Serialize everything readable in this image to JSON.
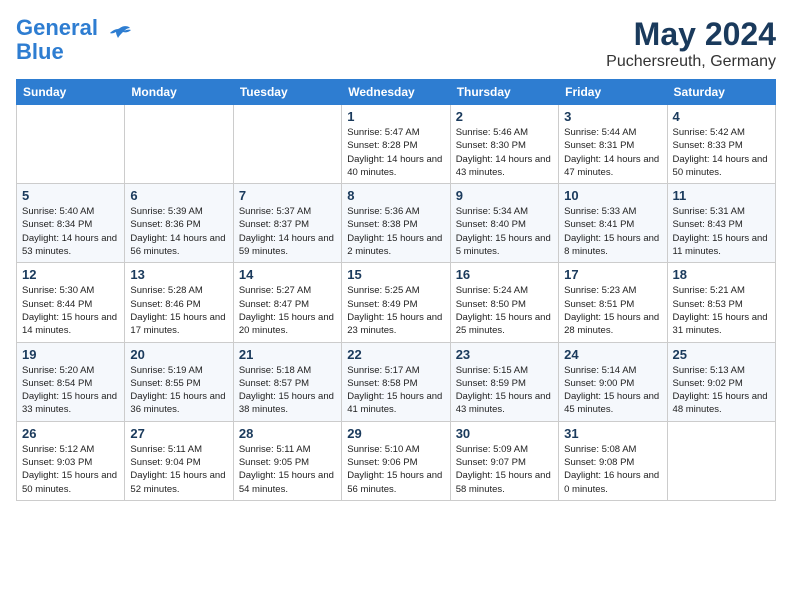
{
  "header": {
    "logo_line1": "General",
    "logo_line2": "Blue",
    "title": "May 2024",
    "subtitle": "Puchersreuth, Germany"
  },
  "weekdays": [
    "Sunday",
    "Monday",
    "Tuesday",
    "Wednesday",
    "Thursday",
    "Friday",
    "Saturday"
  ],
  "weeks": [
    [
      {
        "day": "",
        "info": ""
      },
      {
        "day": "",
        "info": ""
      },
      {
        "day": "",
        "info": ""
      },
      {
        "day": "1",
        "info": "Sunrise: 5:47 AM\nSunset: 8:28 PM\nDaylight: 14 hours and 40 minutes."
      },
      {
        "day": "2",
        "info": "Sunrise: 5:46 AM\nSunset: 8:30 PM\nDaylight: 14 hours and 43 minutes."
      },
      {
        "day": "3",
        "info": "Sunrise: 5:44 AM\nSunset: 8:31 PM\nDaylight: 14 hours and 47 minutes."
      },
      {
        "day": "4",
        "info": "Sunrise: 5:42 AM\nSunset: 8:33 PM\nDaylight: 14 hours and 50 minutes."
      }
    ],
    [
      {
        "day": "5",
        "info": "Sunrise: 5:40 AM\nSunset: 8:34 PM\nDaylight: 14 hours and 53 minutes."
      },
      {
        "day": "6",
        "info": "Sunrise: 5:39 AM\nSunset: 8:36 PM\nDaylight: 14 hours and 56 minutes."
      },
      {
        "day": "7",
        "info": "Sunrise: 5:37 AM\nSunset: 8:37 PM\nDaylight: 14 hours and 59 minutes."
      },
      {
        "day": "8",
        "info": "Sunrise: 5:36 AM\nSunset: 8:38 PM\nDaylight: 15 hours and 2 minutes."
      },
      {
        "day": "9",
        "info": "Sunrise: 5:34 AM\nSunset: 8:40 PM\nDaylight: 15 hours and 5 minutes."
      },
      {
        "day": "10",
        "info": "Sunrise: 5:33 AM\nSunset: 8:41 PM\nDaylight: 15 hours and 8 minutes."
      },
      {
        "day": "11",
        "info": "Sunrise: 5:31 AM\nSunset: 8:43 PM\nDaylight: 15 hours and 11 minutes."
      }
    ],
    [
      {
        "day": "12",
        "info": "Sunrise: 5:30 AM\nSunset: 8:44 PM\nDaylight: 15 hours and 14 minutes."
      },
      {
        "day": "13",
        "info": "Sunrise: 5:28 AM\nSunset: 8:46 PM\nDaylight: 15 hours and 17 minutes."
      },
      {
        "day": "14",
        "info": "Sunrise: 5:27 AM\nSunset: 8:47 PM\nDaylight: 15 hours and 20 minutes."
      },
      {
        "day": "15",
        "info": "Sunrise: 5:25 AM\nSunset: 8:49 PM\nDaylight: 15 hours and 23 minutes."
      },
      {
        "day": "16",
        "info": "Sunrise: 5:24 AM\nSunset: 8:50 PM\nDaylight: 15 hours and 25 minutes."
      },
      {
        "day": "17",
        "info": "Sunrise: 5:23 AM\nSunset: 8:51 PM\nDaylight: 15 hours and 28 minutes."
      },
      {
        "day": "18",
        "info": "Sunrise: 5:21 AM\nSunset: 8:53 PM\nDaylight: 15 hours and 31 minutes."
      }
    ],
    [
      {
        "day": "19",
        "info": "Sunrise: 5:20 AM\nSunset: 8:54 PM\nDaylight: 15 hours and 33 minutes."
      },
      {
        "day": "20",
        "info": "Sunrise: 5:19 AM\nSunset: 8:55 PM\nDaylight: 15 hours and 36 minutes."
      },
      {
        "day": "21",
        "info": "Sunrise: 5:18 AM\nSunset: 8:57 PM\nDaylight: 15 hours and 38 minutes."
      },
      {
        "day": "22",
        "info": "Sunrise: 5:17 AM\nSunset: 8:58 PM\nDaylight: 15 hours and 41 minutes."
      },
      {
        "day": "23",
        "info": "Sunrise: 5:15 AM\nSunset: 8:59 PM\nDaylight: 15 hours and 43 minutes."
      },
      {
        "day": "24",
        "info": "Sunrise: 5:14 AM\nSunset: 9:00 PM\nDaylight: 15 hours and 45 minutes."
      },
      {
        "day": "25",
        "info": "Sunrise: 5:13 AM\nSunset: 9:02 PM\nDaylight: 15 hours and 48 minutes."
      }
    ],
    [
      {
        "day": "26",
        "info": "Sunrise: 5:12 AM\nSunset: 9:03 PM\nDaylight: 15 hours and 50 minutes."
      },
      {
        "day": "27",
        "info": "Sunrise: 5:11 AM\nSunset: 9:04 PM\nDaylight: 15 hours and 52 minutes."
      },
      {
        "day": "28",
        "info": "Sunrise: 5:11 AM\nSunset: 9:05 PM\nDaylight: 15 hours and 54 minutes."
      },
      {
        "day": "29",
        "info": "Sunrise: 5:10 AM\nSunset: 9:06 PM\nDaylight: 15 hours and 56 minutes."
      },
      {
        "day": "30",
        "info": "Sunrise: 5:09 AM\nSunset: 9:07 PM\nDaylight: 15 hours and 58 minutes."
      },
      {
        "day": "31",
        "info": "Sunrise: 5:08 AM\nSunset: 9:08 PM\nDaylight: 16 hours and 0 minutes."
      },
      {
        "day": "",
        "info": ""
      }
    ]
  ]
}
